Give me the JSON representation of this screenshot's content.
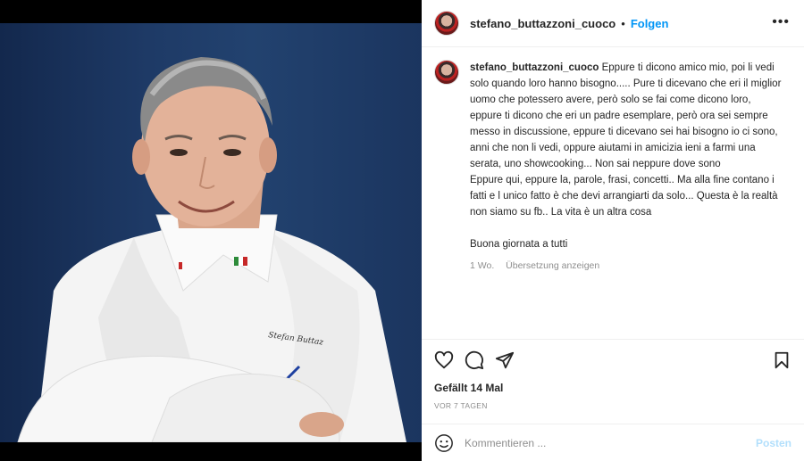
{
  "post": {
    "username": "stefano_buttazzoni_cuoco",
    "separator": "•",
    "follow_label": "Folgen",
    "more_icon": "more-horizontal-icon",
    "caption": {
      "username": "stefano_buttazzoni_cuoco",
      "paragraph_1": " Eppure ti dicono amico mio, poi li vedi solo quando loro hanno bisogno..... Pure ti dicevano che eri il miglior uomo che potessero avere, però solo se fai come dicono loro, eppure ti dicono che eri un padre esemplare, però ora sei sempre messo in discussione, eppure ti dicevano sei hai bisogno io ci sono, anni che non li vedi, oppure aiutami in amicizia ieni a farmi una serata, uno showcooking... Non sai neppure dove sono",
      "paragraph_2": "Eppure qui, eppure la, parole, frasi, concetti.. Ma alla fine contano i fatti e l unico fatto è che devi arrangiarti da solo... Questa è la realtà non siamo su fb.. La vita è un altra cosa",
      "paragraph_3": "Buona giornata a tutti"
    },
    "caption_time": "1 Wo.",
    "translate_label": "Übersetzung anzeigen",
    "likes": "Gefällt 14 Mal",
    "time_ago": "VOR 7 TAGEN",
    "comment_placeholder": "Kommentieren ...",
    "post_button": "Posten"
  },
  "icons": {
    "like": "heart-icon",
    "comment": "comment-icon",
    "share": "share-icon",
    "save": "bookmark-icon",
    "emoji": "emoji-icon"
  },
  "colors": {
    "accent": "#0095f6",
    "post_disabled": "#b2dffc",
    "muted": "#8e8e8e",
    "photo_background": "#1e3a66"
  }
}
